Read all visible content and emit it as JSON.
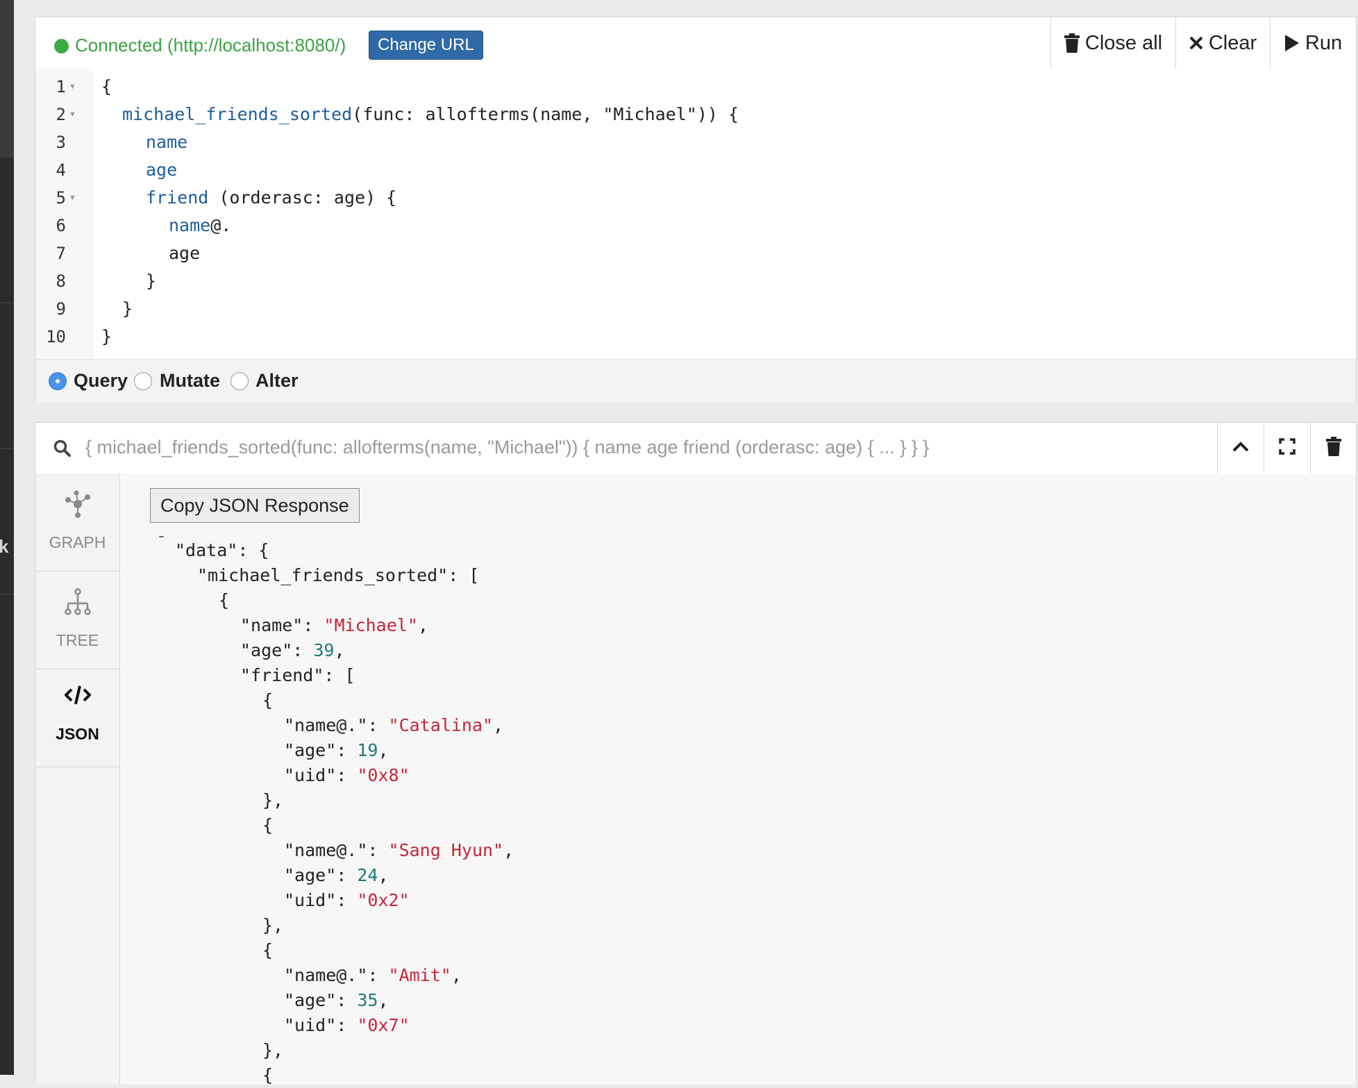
{
  "editor": {
    "status_text": "Connected (http://localhost:8080/)",
    "change_url_label": "Change URL",
    "close_all_label": "Close all",
    "clear_label": "Clear",
    "run_label": "Run",
    "code_lines": [
      {
        "num": "1",
        "fold": true
      },
      {
        "num": "2",
        "fold": true
      },
      {
        "num": "3",
        "fold": false
      },
      {
        "num": "4",
        "fold": false
      },
      {
        "num": "5",
        "fold": true
      },
      {
        "num": "6",
        "fold": false
      },
      {
        "num": "7",
        "fold": false
      },
      {
        "num": "8",
        "fold": false
      },
      {
        "num": "9",
        "fold": false
      },
      {
        "num": "10",
        "fold": false
      }
    ],
    "code": {
      "l1": "{",
      "l2_kw": "michael_friends_sorted",
      "l2_rest": "(func: allofterms(name, \"Michael\")) {",
      "l3": "name",
      "l4": "age",
      "l5_kw": "friend",
      "l5_rest": " (orderasc: age) {",
      "l6_kw": "name",
      "l6_rest": "@.",
      "l7": "age",
      "l8": "}",
      "l9": "}",
      "l10": "}"
    },
    "modes": {
      "query": "Query",
      "mutate": "Mutate",
      "alter": "Alter",
      "selected": "Query"
    }
  },
  "result": {
    "query_summary": "{ michael_friends_sorted(func: allofterms(name, \"Michael\")) { name age friend (orderasc: age) { ... } } }",
    "tabs": {
      "graph": "GRAPH",
      "tree": "TREE",
      "json": "JSON",
      "active": "JSON"
    },
    "copy_label": "Copy JSON Response",
    "json": {
      "dash": "-",
      "data_key": "\"data\"",
      "root_key": "\"michael_friends_sorted\"",
      "name_key": "\"name\"",
      "name_val": "\"Michael\"",
      "age_key": "\"age\"",
      "age_val": "39",
      "friend_key": "\"friend\"",
      "friends": [
        {
          "name_key": "\"name@.\"",
          "name": "\"Catalina\"",
          "age_key": "\"age\"",
          "age": "19",
          "uid_key": "\"uid\"",
          "uid": "\"0x8\""
        },
        {
          "name_key": "\"name@.\"",
          "name": "\"Sang Hyun\"",
          "age_key": "\"age\"",
          "age": "24",
          "uid_key": "\"uid\"",
          "uid": "\"0x2\""
        },
        {
          "name_key": "\"name@.\"",
          "name": "\"Amit\"",
          "age_key": "\"age\"",
          "age": "35",
          "uid_key": "\"uid\"",
          "uid": "\"0x7\""
        }
      ]
    }
  },
  "colors": {
    "connected": "#3aa245",
    "change_url_bg": "#2f6aa6",
    "keyword": "#1d5e99",
    "json_string": "#c0283a",
    "json_number": "#1f7a7a"
  }
}
